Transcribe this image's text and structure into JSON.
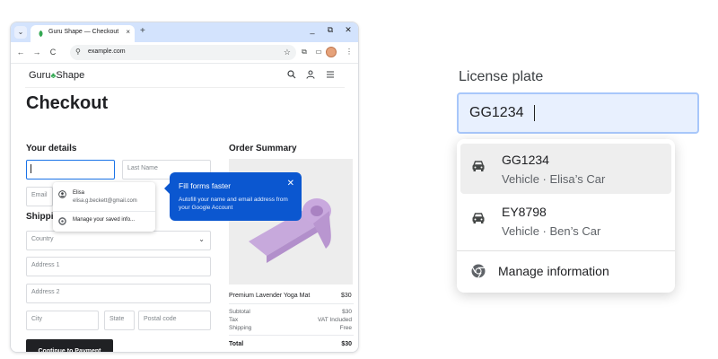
{
  "browser": {
    "tab_title": "Guru Shape — Checkout",
    "tab_close": "×",
    "new_tab": "+",
    "tab_list": "⌄",
    "window_controls": [
      "_",
      "⧉",
      "✕"
    ],
    "url": "example.com",
    "nav": {
      "back": "←",
      "forward": "→",
      "reload": "C"
    }
  },
  "site": {
    "logo_left": "Guru",
    "logo_right": "Shape",
    "page_title": "Checkout",
    "your_details": "Your details",
    "shipping": "Shipping",
    "order_summary": "Order Summary"
  },
  "fields": {
    "last_name": "Last Name",
    "email": "Email",
    "country": "Country",
    "address1": "Address 1",
    "address2": "Address 2",
    "city": "City",
    "state": "State",
    "postal": "Postal code"
  },
  "continue_button": "Continue to Payment",
  "autofill_small": {
    "name": "Elisa",
    "email": "elisa.g.beckett@gmail.com",
    "manage": "Manage your saved info..."
  },
  "iph": {
    "title": "Fill forms faster",
    "body": "Autofill your name and email address from your Google Account",
    "close": "✕"
  },
  "order": {
    "product": "Premium Lavender Yoga Mat",
    "product_price": "$30",
    "subtotal_label": "Subtotal",
    "subtotal_value": "$30",
    "tax_label": "Tax",
    "tax_value": "VAT Included",
    "shipping_label": "Shipping",
    "shipping_value": "Free",
    "total_label": "Total",
    "total_value": "$30"
  },
  "license": {
    "label": "License plate",
    "value": "GG1234",
    "suggestions": [
      {
        "main": "GG1234",
        "sub": "Vehicle · Elisa’s Car"
      },
      {
        "main": "EY8798",
        "sub": "Vehicle · Ben’s Car"
      }
    ],
    "manage": "Manage information"
  },
  "colors": {
    "accent_blue": "#0b57d0",
    "tabstrip": "#d3e3fd",
    "input_focus_bg": "#e8f0fe",
    "button_dark": "#202124"
  }
}
